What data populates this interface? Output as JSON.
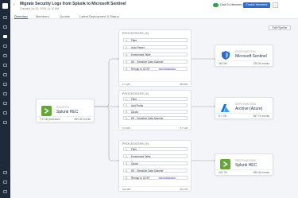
{
  "header": {
    "title": "Migrate Security Logs from Splunk to Microsoft Sentinel",
    "subtitle": "Created Jul 15, 2024 11:12 AM",
    "toggle_label": "Data To Members",
    "enable_button": "Enable Members",
    "more_label": "⋯"
  },
  "tabs": [
    "Overview",
    "Members",
    "Quotas",
    "Latest Deployment & Status"
  ],
  "edit_pipeline": "Edit Pipeline",
  "source": {
    "kind": "SOURCE",
    "name": "Splunk HEC",
    "foot_left": "7.9 GB processed",
    "foot_right": "894.3K events"
  },
  "destinations": [
    {
      "kind": "DESTINATION",
      "name": "Microsoft Sentinel",
      "foot_left": "462.5M",
      "foot_right": "325.3K events"
    },
    {
      "kind": "DESTINATION",
      "name": "Archive (Azure)",
      "foot_left": "8.7 GB",
      "foot_right": "857.7K events"
    },
    {
      "kind": "DESTINATION",
      "name": "Splunk HEC",
      "foot_left": "442.7M",
      "foot_right": "285.4K events"
    }
  ],
  "processors": [
    {
      "head": "PROCESSORS (5)",
      "rows": [
        {
          "idx": "1.",
          "label": "Filter",
          "badge": ""
        },
        {
          "idx": "2.",
          "label": "Auto Parser",
          "badge": ""
        },
        {
          "idx": "3.",
          "label": "Enrichment Table",
          "badge": ""
        },
        {
          "idx": "4.",
          "label": "DE - Sensitive Data Scanner",
          "badge": ""
        },
        {
          "idx": "5.",
          "label": "Remap to OCSF",
          "badge": "RECOMMENDED"
        }
      ],
      "foot_left": "1.4 GB",
      "foot_right": "462.5M"
    },
    {
      "head": "PROCESSORS (4)",
      "rows": [
        {
          "idx": "1.",
          "label": "Filter",
          "badge": ""
        },
        {
          "idx": "2.",
          "label": "Add Fields",
          "badge": ""
        },
        {
          "idx": "3.",
          "label": "Quota",
          "badge": ""
        },
        {
          "idx": "4.",
          "label": "DE - Sensitive Data Scanner",
          "badge": ""
        }
      ],
      "foot_left": "6.4 GB",
      "foot_right": "8.7 GB"
    },
    {
      "head": "PROCESSORS (5)",
      "rows": [
        {
          "idx": "1.",
          "label": "Filter",
          "badge": ""
        },
        {
          "idx": "2.",
          "label": "Enrichment Table",
          "badge": ""
        },
        {
          "idx": "3.",
          "label": "Quota",
          "badge": ""
        },
        {
          "idx": "4.",
          "label": "DE - Sensitive Data Scanner",
          "badge": ""
        },
        {
          "idx": "5.",
          "label": "Remap to OCSF",
          "badge": "RECOMMENDED"
        }
      ],
      "foot_left": "612.2M",
      "foot_right": "442.7M"
    }
  ],
  "colors": {
    "splunk": "#65a637",
    "sentinel": "#2d6cc6",
    "azure": "#0a74d1",
    "accent": "#2d6cc6"
  }
}
